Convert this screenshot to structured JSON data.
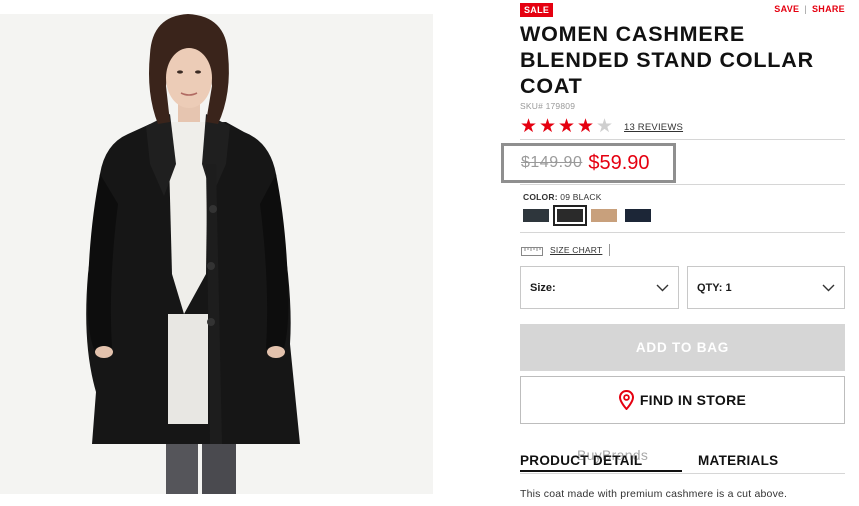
{
  "product": {
    "badge": "SALE",
    "links": {
      "save": "SAVE",
      "share": "SHARE"
    },
    "title": "WOMEN CASHMERE BLENDED STAND COLLAR COAT",
    "sku": "SKU# 179809",
    "rating": {
      "value": 4,
      "max": 5,
      "reviews": "13 REVIEWS"
    },
    "price": {
      "original": "$149.90",
      "sale": "$59.90"
    },
    "color": {
      "label": "COLOR:",
      "selected": "09 BLACK"
    },
    "swatches": [
      {
        "name": "charcoal-gray",
        "color": "#2e363c"
      },
      {
        "name": "black",
        "color": "#2a2a2a",
        "selected": true
      },
      {
        "name": "camel",
        "color": "#c8a07c"
      },
      {
        "name": "navy",
        "color": "#1c2637"
      }
    ],
    "size_chart": "SIZE CHART",
    "size_select": {
      "label": "Size:"
    },
    "qty_select": {
      "label": "QTY: 1"
    },
    "add_to_bag": "ADD TO BAG",
    "find_in_store": "FIND IN STORE",
    "tabs": {
      "detail": "PRODUCT DETAIL",
      "materials": "MATERIALS"
    },
    "watermark": "BuyBrands",
    "description": "This coat made with premium cashmere is a cut above."
  },
  "colors": {
    "accent": "#e50010",
    "button_disabled": "#d6d6d6"
  }
}
